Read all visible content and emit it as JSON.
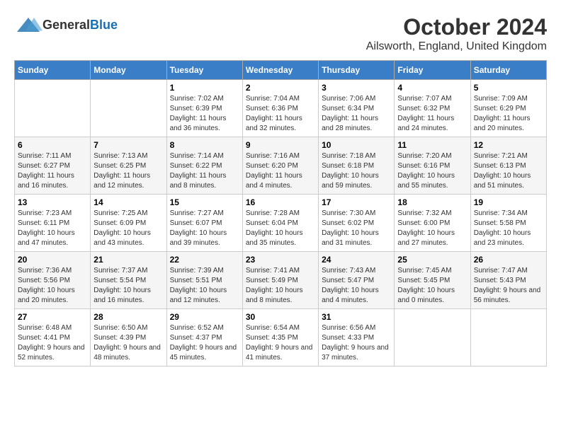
{
  "logo": {
    "general": "General",
    "blue": "Blue"
  },
  "title": "October 2024",
  "subtitle": "Ailsworth, England, United Kingdom",
  "days_of_week": [
    "Sunday",
    "Monday",
    "Tuesday",
    "Wednesday",
    "Thursday",
    "Friday",
    "Saturday"
  ],
  "weeks": [
    [
      {
        "day": "",
        "info": ""
      },
      {
        "day": "",
        "info": ""
      },
      {
        "day": "1",
        "info": "Sunrise: 7:02 AM\nSunset: 6:39 PM\nDaylight: 11 hours and 36 minutes."
      },
      {
        "day": "2",
        "info": "Sunrise: 7:04 AM\nSunset: 6:36 PM\nDaylight: 11 hours and 32 minutes."
      },
      {
        "day": "3",
        "info": "Sunrise: 7:06 AM\nSunset: 6:34 PM\nDaylight: 11 hours and 28 minutes."
      },
      {
        "day": "4",
        "info": "Sunrise: 7:07 AM\nSunset: 6:32 PM\nDaylight: 11 hours and 24 minutes."
      },
      {
        "day": "5",
        "info": "Sunrise: 7:09 AM\nSunset: 6:29 PM\nDaylight: 11 hours and 20 minutes."
      }
    ],
    [
      {
        "day": "6",
        "info": "Sunrise: 7:11 AM\nSunset: 6:27 PM\nDaylight: 11 hours and 16 minutes."
      },
      {
        "day": "7",
        "info": "Sunrise: 7:13 AM\nSunset: 6:25 PM\nDaylight: 11 hours and 12 minutes."
      },
      {
        "day": "8",
        "info": "Sunrise: 7:14 AM\nSunset: 6:22 PM\nDaylight: 11 hours and 8 minutes."
      },
      {
        "day": "9",
        "info": "Sunrise: 7:16 AM\nSunset: 6:20 PM\nDaylight: 11 hours and 4 minutes."
      },
      {
        "day": "10",
        "info": "Sunrise: 7:18 AM\nSunset: 6:18 PM\nDaylight: 10 hours and 59 minutes."
      },
      {
        "day": "11",
        "info": "Sunrise: 7:20 AM\nSunset: 6:16 PM\nDaylight: 10 hours and 55 minutes."
      },
      {
        "day": "12",
        "info": "Sunrise: 7:21 AM\nSunset: 6:13 PM\nDaylight: 10 hours and 51 minutes."
      }
    ],
    [
      {
        "day": "13",
        "info": "Sunrise: 7:23 AM\nSunset: 6:11 PM\nDaylight: 10 hours and 47 minutes."
      },
      {
        "day": "14",
        "info": "Sunrise: 7:25 AM\nSunset: 6:09 PM\nDaylight: 10 hours and 43 minutes."
      },
      {
        "day": "15",
        "info": "Sunrise: 7:27 AM\nSunset: 6:07 PM\nDaylight: 10 hours and 39 minutes."
      },
      {
        "day": "16",
        "info": "Sunrise: 7:28 AM\nSunset: 6:04 PM\nDaylight: 10 hours and 35 minutes."
      },
      {
        "day": "17",
        "info": "Sunrise: 7:30 AM\nSunset: 6:02 PM\nDaylight: 10 hours and 31 minutes."
      },
      {
        "day": "18",
        "info": "Sunrise: 7:32 AM\nSunset: 6:00 PM\nDaylight: 10 hours and 27 minutes."
      },
      {
        "day": "19",
        "info": "Sunrise: 7:34 AM\nSunset: 5:58 PM\nDaylight: 10 hours and 23 minutes."
      }
    ],
    [
      {
        "day": "20",
        "info": "Sunrise: 7:36 AM\nSunset: 5:56 PM\nDaylight: 10 hours and 20 minutes."
      },
      {
        "day": "21",
        "info": "Sunrise: 7:37 AM\nSunset: 5:54 PM\nDaylight: 10 hours and 16 minutes."
      },
      {
        "day": "22",
        "info": "Sunrise: 7:39 AM\nSunset: 5:51 PM\nDaylight: 10 hours and 12 minutes."
      },
      {
        "day": "23",
        "info": "Sunrise: 7:41 AM\nSunset: 5:49 PM\nDaylight: 10 hours and 8 minutes."
      },
      {
        "day": "24",
        "info": "Sunrise: 7:43 AM\nSunset: 5:47 PM\nDaylight: 10 hours and 4 minutes."
      },
      {
        "day": "25",
        "info": "Sunrise: 7:45 AM\nSunset: 5:45 PM\nDaylight: 10 hours and 0 minutes."
      },
      {
        "day": "26",
        "info": "Sunrise: 7:47 AM\nSunset: 5:43 PM\nDaylight: 9 hours and 56 minutes."
      }
    ],
    [
      {
        "day": "27",
        "info": "Sunrise: 6:48 AM\nSunset: 4:41 PM\nDaylight: 9 hours and 52 minutes."
      },
      {
        "day": "28",
        "info": "Sunrise: 6:50 AM\nSunset: 4:39 PM\nDaylight: 9 hours and 48 minutes."
      },
      {
        "day": "29",
        "info": "Sunrise: 6:52 AM\nSunset: 4:37 PM\nDaylight: 9 hours and 45 minutes."
      },
      {
        "day": "30",
        "info": "Sunrise: 6:54 AM\nSunset: 4:35 PM\nDaylight: 9 hours and 41 minutes."
      },
      {
        "day": "31",
        "info": "Sunrise: 6:56 AM\nSunset: 4:33 PM\nDaylight: 9 hours and 37 minutes."
      },
      {
        "day": "",
        "info": ""
      },
      {
        "day": "",
        "info": ""
      }
    ]
  ]
}
